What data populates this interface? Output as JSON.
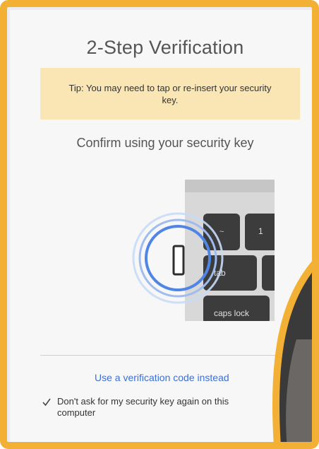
{
  "dialog": {
    "title": "2-Step Verification",
    "tip": "Tip: You may need to tap or re-insert your security key.",
    "confirm_heading": "Confirm using your security key"
  },
  "keyboard": {
    "keys": [
      "~",
      "1",
      "tab",
      "caps lock"
    ]
  },
  "footer": {
    "alt_link": "Use a verification code instead",
    "remember_checkbox_label": "Don't ask for my security key again on this computer",
    "remember_checked": true
  },
  "colors": {
    "frame_border": "#f2b134",
    "tip_background": "#f9e6b4",
    "link": "#3b6fd6",
    "ripple": "#4f86e6"
  }
}
